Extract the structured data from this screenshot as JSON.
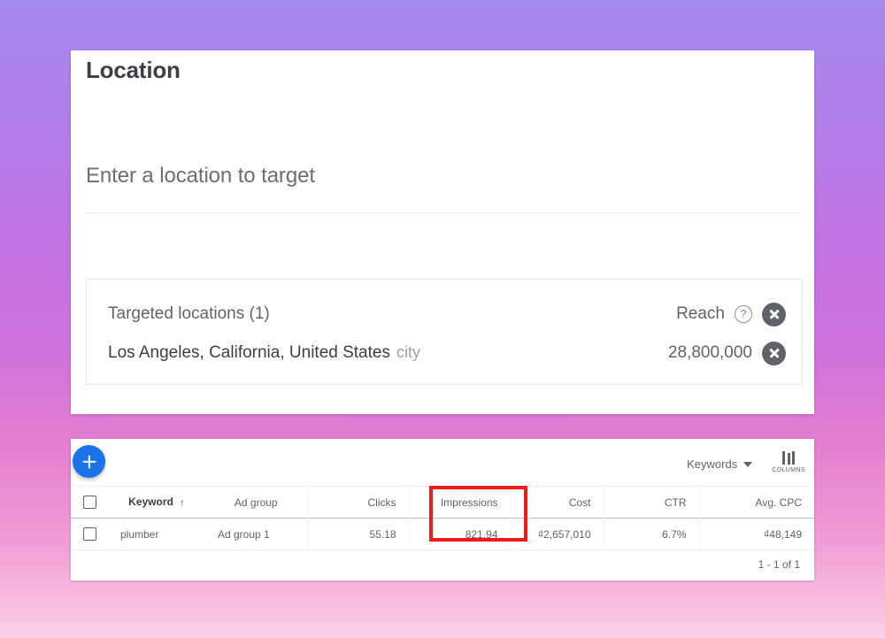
{
  "background": {
    "gradient_from": "#a68aee",
    "gradient_to": "#fbd3e8"
  },
  "location_panel": {
    "title": "Location",
    "input": {
      "value": "",
      "placeholder": "Enter a location to target"
    },
    "targeted": {
      "header_label": "Targeted locations (1)",
      "reach_label": "Reach",
      "help_icon": "help-circle-icon",
      "remove_icon": "close-circle-icon",
      "rows": [
        {
          "name": "Los Angeles, California, United States",
          "type": "city",
          "reach": "28,800,000"
        }
      ]
    }
  },
  "table_panel": {
    "add_button_label": "+",
    "view_select": {
      "label": "Keywords",
      "icon": "chevron-down-icon"
    },
    "columns_button": {
      "label": "COLUMNS",
      "icon": "columns-icon"
    },
    "pagination": "1 - 1 of 1",
    "highlighted_column": "Impressions",
    "highlight_color": "#ec1c1c",
    "sort": {
      "column": "Keyword",
      "direction_icon": "arrow-up-icon"
    },
    "columns": [
      "Keyword",
      "Ad group",
      "Clicks",
      "Impressions",
      "Cost",
      "CTR",
      "Avg. CPC"
    ],
    "rows": [
      {
        "checked": false,
        "keyword": "plumber",
        "ad_group": "Ad group 1",
        "clicks": "55.18",
        "impressions": "821.94",
        "cost": "₫2,657,010",
        "ctr": "6.7%",
        "avg_cpc": "₫48,149"
      }
    ]
  }
}
